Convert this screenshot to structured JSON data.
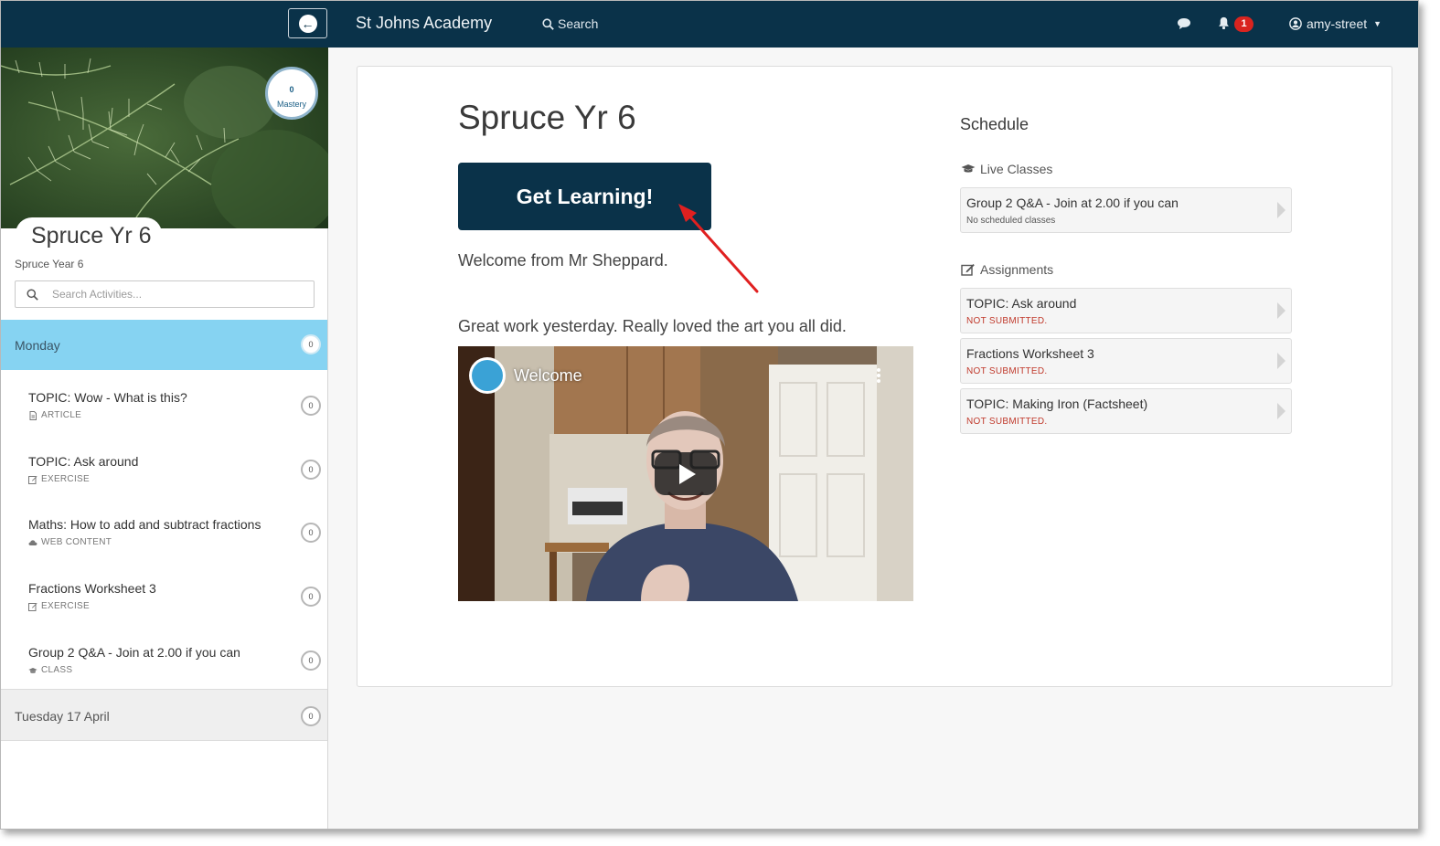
{
  "topnav": {
    "brand": "St Johns Academy",
    "search_label": "Search",
    "notification_count": "1",
    "username": "amy-street",
    "bar_color": "#0a3249"
  },
  "sidebar": {
    "mastery_value": "0",
    "mastery_label": "Mastery",
    "course_title": "Spruce Yr 6",
    "course_subtitle": "Spruce Year 6",
    "search_placeholder": "Search Activities...",
    "monday": {
      "label": "Monday",
      "count": "0",
      "color": "#86d3f2"
    },
    "activities": [
      {
        "title": "TOPIC: Wow - What is this?",
        "kind": "ARTICLE",
        "icon": "article-icon",
        "count": "0"
      },
      {
        "title": "TOPIC: Ask around",
        "kind": "EXERCISE",
        "icon": "exercise-icon",
        "count": "0"
      },
      {
        "title": "Maths: How to add and subtract fractions",
        "kind": "WEB CONTENT",
        "icon": "cloud-icon",
        "count": "0"
      },
      {
        "title": "Fractions Worksheet 3",
        "kind": "EXERCISE",
        "icon": "exercise-icon",
        "count": "0"
      },
      {
        "title": "Group 2 Q&A - Join at 2.00 if you can",
        "kind": "CLASS",
        "icon": "graduation-cap-icon",
        "count": "0"
      }
    ],
    "tuesday": {
      "label": "Tuesday 17 April",
      "count": "0"
    }
  },
  "main": {
    "title": "Spruce Yr 6",
    "cta_label": "Get Learning!",
    "welcome_text": "Welcome from Mr Sheppard.",
    "note_text": "Great work yesterday. Really loved the art you all did.",
    "video": {
      "title": "Welcome"
    }
  },
  "schedule": {
    "title": "Schedule",
    "live_classes": {
      "heading": "Live Classes",
      "items": [
        {
          "title": "Group 2 Q&A - Join at 2.00 if you can",
          "status": "No scheduled classes"
        }
      ]
    },
    "assignments": {
      "heading": "Assignments",
      "items": [
        {
          "title": "TOPIC: Ask around",
          "status": "NOT SUBMITTED."
        },
        {
          "title": "Fractions Worksheet 3",
          "status": "NOT SUBMITTED."
        },
        {
          "title": "TOPIC: Making Iron (Factsheet)",
          "status": "NOT SUBMITTED."
        }
      ]
    },
    "status_color": "#c0392b"
  }
}
